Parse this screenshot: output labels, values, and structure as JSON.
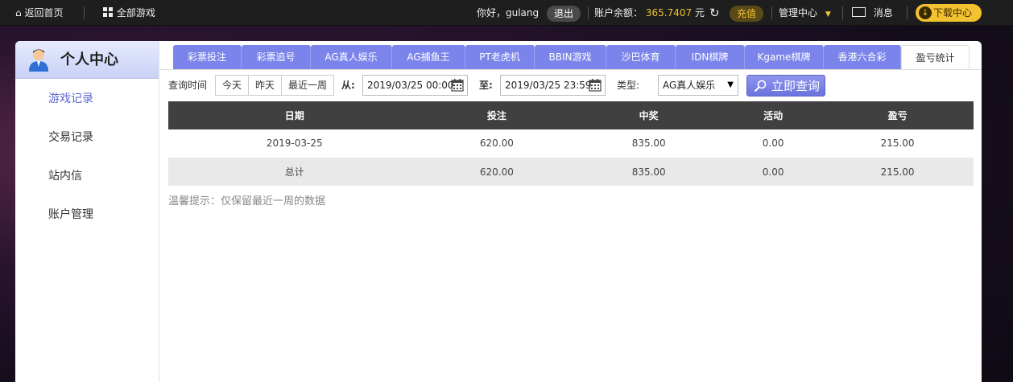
{
  "topbar": {
    "home": "返回首页",
    "all_games": "全部游戏",
    "greeting": "你好，gulang",
    "logout": "退出",
    "balance_label": "账户余额：",
    "balance_value": "365.7407",
    "balance_unit": "元",
    "recharge": "充值",
    "manage": "管理中心",
    "messages": "消息",
    "download": "下载中心"
  },
  "sidebar": {
    "title": "个人中心",
    "items": [
      {
        "label": "游戏记录"
      },
      {
        "label": "交易记录"
      },
      {
        "label": "站内信"
      },
      {
        "label": "账户管理"
      }
    ]
  },
  "tabs": [
    {
      "label": "彩票投注"
    },
    {
      "label": "彩票追号"
    },
    {
      "label": "AG真人娱乐"
    },
    {
      "label": "AG捕鱼王"
    },
    {
      "label": "PT老虎机"
    },
    {
      "label": "BBIN游戏"
    },
    {
      "label": "沙巴体育"
    },
    {
      "label": "IDN棋牌"
    },
    {
      "label": "Kgame棋牌"
    },
    {
      "label": "香港六合彩"
    },
    {
      "label": "盈亏统计"
    }
  ],
  "filter": {
    "query_time_label": "查询时间",
    "quick": [
      "今天",
      "昨天",
      "最近一周"
    ],
    "from_label": "从:",
    "from_value": "2019/03/25 00:00",
    "to_label": "至:",
    "to_value": "2019/03/25 23:59",
    "type_label": "类型:",
    "type_value": "AG真人娱乐",
    "query_button": "立即查询"
  },
  "table": {
    "headers": [
      "日期",
      "投注",
      "中奖",
      "活动",
      "盈亏"
    ],
    "rows": [
      [
        "2019-03-25",
        "620.00",
        "835.00",
        "0.00",
        "215.00"
      ],
      [
        "总计",
        "620.00",
        "835.00",
        "0.00",
        "215.00"
      ]
    ]
  },
  "tip": "温馨提示：仅保留最近一周的数据"
}
